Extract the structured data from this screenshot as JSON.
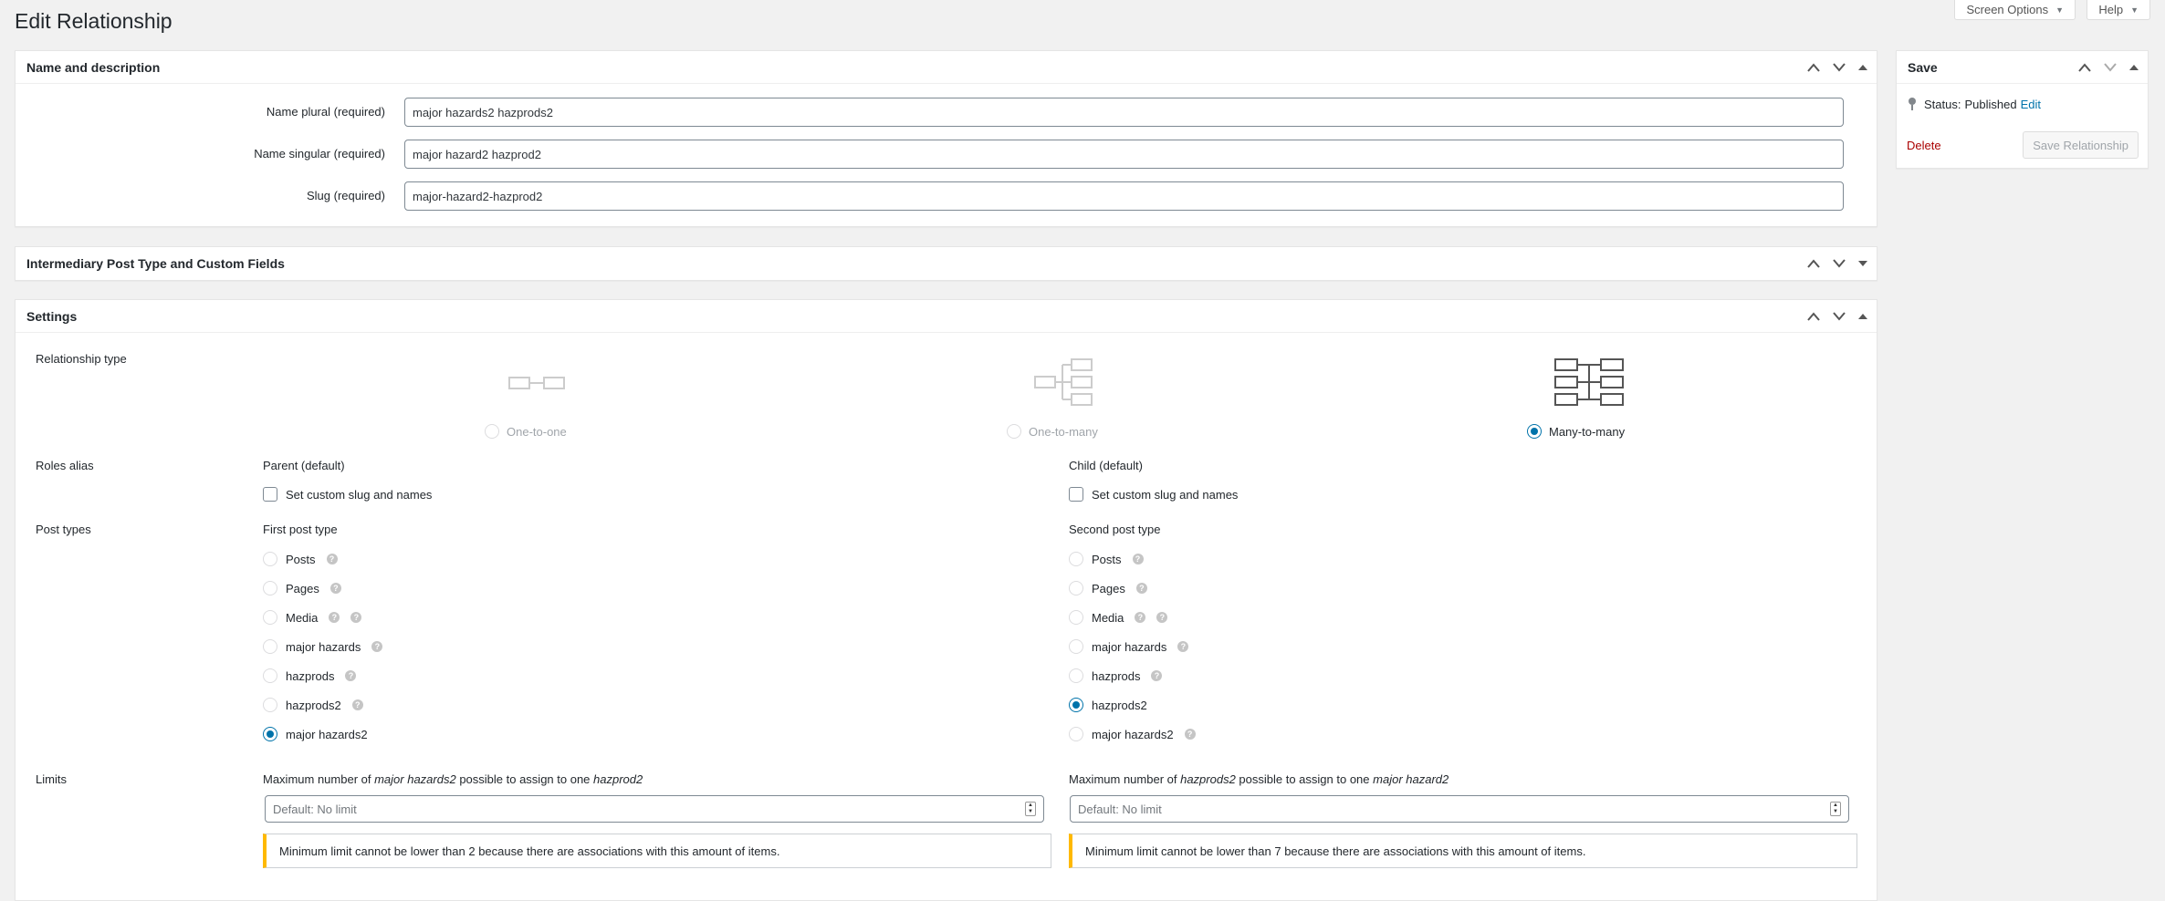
{
  "top_tabs": {
    "screen_options": "Screen Options",
    "help": "Help"
  },
  "page_title": "Edit Relationship",
  "name_box": {
    "title": "Name and description",
    "fields": [
      {
        "label": "Name plural",
        "required": "(required)",
        "value": "major hazards2 hazprods2"
      },
      {
        "label": "Name singular",
        "required": "(required)",
        "value": "major hazard2 hazprod2"
      },
      {
        "label": "Slug",
        "required": "(required)",
        "value": "major-hazard2-hazprod2"
      }
    ]
  },
  "intermediary_box": {
    "title": "Intermediary Post Type and Custom Fields"
  },
  "settings_box": {
    "title": "Settings",
    "relationship_type": {
      "label": "Relationship type",
      "options": [
        {
          "label": "One-to-one",
          "selected": false,
          "enabled": false
        },
        {
          "label": "One-to-many",
          "selected": false,
          "enabled": false
        },
        {
          "label": "Many-to-many",
          "selected": true,
          "enabled": true
        }
      ]
    },
    "roles_alias": {
      "label": "Roles alias",
      "parent": {
        "heading": "Parent (default)",
        "checkbox_label": "Set custom slug and names"
      },
      "child": {
        "heading": "Child (default)",
        "checkbox_label": "Set custom slug and names"
      }
    },
    "post_types": {
      "label": "Post types",
      "first": {
        "heading": "First post type",
        "options": [
          {
            "label": "Posts",
            "help_icons": 1,
            "selected": false
          },
          {
            "label": "Pages",
            "help_icons": 1,
            "selected": false
          },
          {
            "label": "Media",
            "help_icons": 2,
            "selected": false
          },
          {
            "label": "major hazards",
            "help_icons": 1,
            "selected": false
          },
          {
            "label": "hazprods",
            "help_icons": 1,
            "selected": false
          },
          {
            "label": "hazprods2",
            "help_icons": 1,
            "selected": false
          },
          {
            "label": "major hazards2",
            "help_icons": 0,
            "selected": true
          }
        ]
      },
      "second": {
        "heading": "Second post type",
        "options": [
          {
            "label": "Posts",
            "help_icons": 1,
            "selected": false
          },
          {
            "label": "Pages",
            "help_icons": 1,
            "selected": false
          },
          {
            "label": "Media",
            "help_icons": 2,
            "selected": false
          },
          {
            "label": "major hazards",
            "help_icons": 1,
            "selected": false
          },
          {
            "label": "hazprods",
            "help_icons": 1,
            "selected": false
          },
          {
            "label": "hazprods2",
            "help_icons": 0,
            "selected": true
          },
          {
            "label": "major hazards2",
            "help_icons": 1,
            "selected": false
          }
        ]
      }
    },
    "limits": {
      "label": "Limits",
      "first": {
        "text_prefix": "Maximum number of ",
        "em1": "major hazards2",
        "text_mid": " possible to assign to one ",
        "em2": "hazprod2",
        "placeholder": "Default: No limit",
        "notice": "Minimum limit cannot be lower than 2 because there are associations with this amount of items."
      },
      "second": {
        "text_prefix": "Maximum number of ",
        "em1": "hazprods2",
        "text_mid": " possible to assign to one ",
        "em2": "major hazard2",
        "placeholder": "Default: No limit",
        "notice": "Minimum limit cannot be lower than 7 because there are associations with this amount of items."
      }
    }
  },
  "save_box": {
    "title": "Save",
    "status_label": "Status:",
    "status_value": "Published",
    "edit_link": "Edit",
    "delete_link": "Delete",
    "save_button": "Save Relationship"
  },
  "colors": {
    "link": "#0073aa",
    "delete": "#aa0000",
    "notice_warning": "#ffb900"
  }
}
